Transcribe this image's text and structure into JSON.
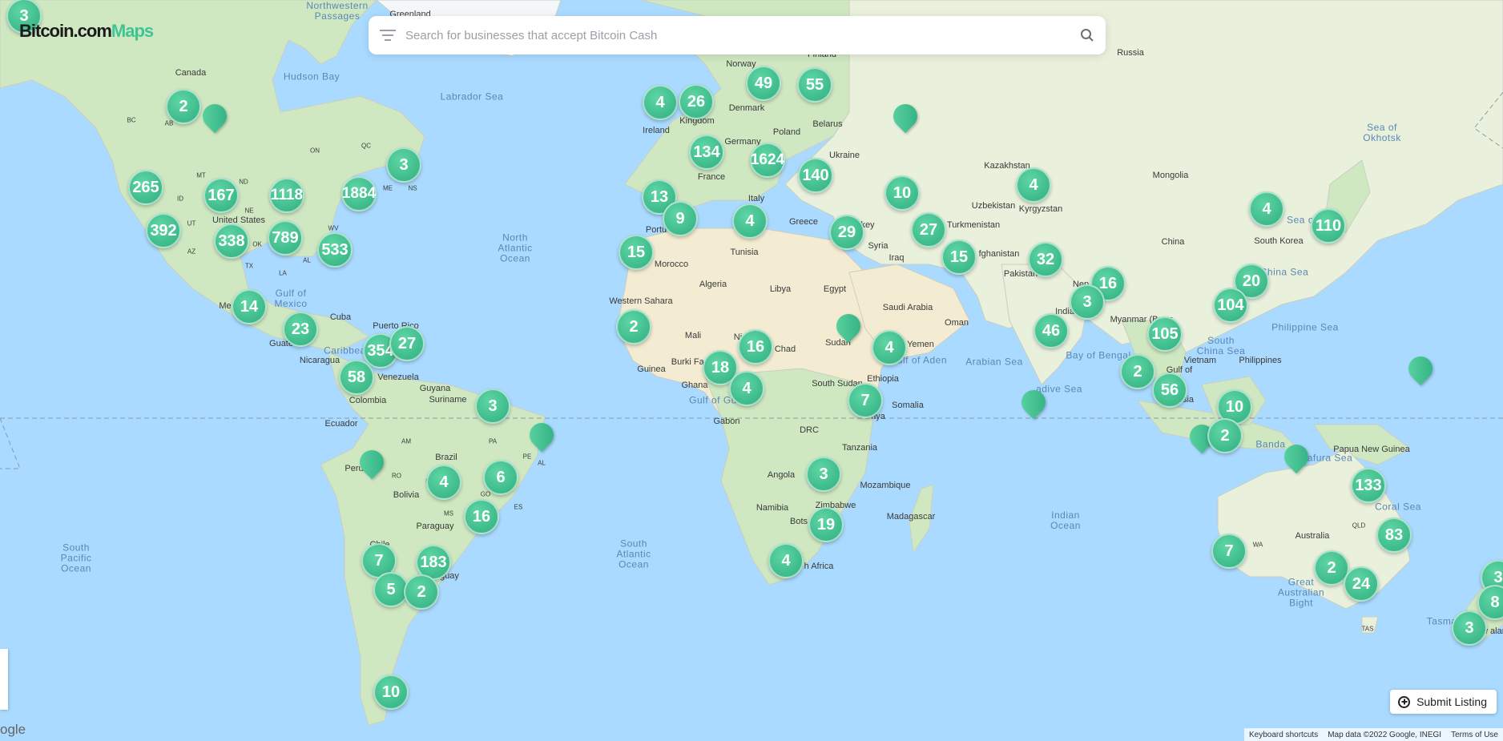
{
  "logo": {
    "brand": "Bitcoin.com",
    "product": "Maps"
  },
  "search": {
    "placeholder": "Search for businesses that accept Bitcoin Cash",
    "value": ""
  },
  "submit_listing": {
    "label": "Submit Listing"
  },
  "attribution": {
    "shortcuts": "Keyboard shortcuts",
    "map_data": "Map data ©2022 Google, INEGI",
    "terms": "Terms of Use"
  },
  "google_logo": "ogle",
  "colors": {
    "marker": "#3fc495",
    "water": "#aadaff",
    "land": "#e9f0dc"
  },
  "clusters": [
    {
      "label": "3",
      "id": "top-left"
    },
    {
      "label": "2",
      "id": "canada-west"
    },
    {
      "label": "265",
      "id": "us-northwest"
    },
    {
      "label": "167",
      "id": "us-mountain"
    },
    {
      "label": "1118",
      "id": "us-midwest"
    },
    {
      "label": "1884",
      "id": "us-northeast"
    },
    {
      "label": "3",
      "id": "canada-east"
    },
    {
      "label": "392",
      "id": "us-california"
    },
    {
      "label": "338",
      "id": "us-texas"
    },
    {
      "label": "789",
      "id": "us-south"
    },
    {
      "label": "533",
      "id": "us-southeast"
    },
    {
      "label": "14",
      "id": "mexico"
    },
    {
      "label": "23",
      "id": "central-america"
    },
    {
      "label": "354",
      "id": "caribbean"
    },
    {
      "label": "27",
      "id": "puerto-rico"
    },
    {
      "label": "58",
      "id": "colombia"
    },
    {
      "label": "3",
      "id": "guyana"
    },
    {
      "label": "4",
      "id": "brazil-west"
    },
    {
      "label": "6",
      "id": "brazil-east"
    },
    {
      "label": "16",
      "id": "brazil-south"
    },
    {
      "label": "7",
      "id": "chile-north"
    },
    {
      "label": "183",
      "id": "argentina"
    },
    {
      "label": "5",
      "id": "chile-central"
    },
    {
      "label": "2",
      "id": "uruguay"
    },
    {
      "label": "10",
      "id": "patagonia"
    },
    {
      "label": "4",
      "id": "ireland"
    },
    {
      "label": "26",
      "id": "uk"
    },
    {
      "label": "49",
      "id": "norway"
    },
    {
      "label": "55",
      "id": "finland"
    },
    {
      "label": "134",
      "id": "france"
    },
    {
      "label": "1624",
      "id": "central-europe"
    },
    {
      "label": "140",
      "id": "eastern-europe"
    },
    {
      "label": "13",
      "id": "spain"
    },
    {
      "label": "9",
      "id": "portugal"
    },
    {
      "label": "4",
      "id": "italy"
    },
    {
      "label": "29",
      "id": "turkey"
    },
    {
      "label": "10",
      "id": "caucasus"
    },
    {
      "label": "27",
      "id": "iran"
    },
    {
      "label": "15",
      "id": "pakistan"
    },
    {
      "label": "4",
      "id": "kyrgyzstan"
    },
    {
      "label": "32",
      "id": "india-north"
    },
    {
      "label": "16",
      "id": "nepal"
    },
    {
      "label": "3",
      "id": "bangladesh"
    },
    {
      "label": "46",
      "id": "india-south"
    },
    {
      "label": "15",
      "id": "morocco"
    },
    {
      "label": "2",
      "id": "mauritania"
    },
    {
      "label": "16",
      "id": "nigeria"
    },
    {
      "label": "18",
      "id": "ghana"
    },
    {
      "label": "4",
      "id": "cameroon"
    },
    {
      "label": "4",
      "id": "ethiopia"
    },
    {
      "label": "7",
      "id": "kenya"
    },
    {
      "label": "3",
      "id": "zambia"
    },
    {
      "label": "19",
      "id": "zimbabwe"
    },
    {
      "label": "4",
      "id": "south-africa"
    },
    {
      "label": "4",
      "id": "korea"
    },
    {
      "label": "110",
      "id": "japan"
    },
    {
      "label": "20",
      "id": "taiwan"
    },
    {
      "label": "104",
      "id": "hong-kong"
    },
    {
      "label": "105",
      "id": "thailand"
    },
    {
      "label": "2",
      "id": "malaysia"
    },
    {
      "label": "56",
      "id": "singapore"
    },
    {
      "label": "10",
      "id": "borneo"
    },
    {
      "label": "2",
      "id": "indonesia"
    },
    {
      "label": "133",
      "id": "queensland"
    },
    {
      "label": "83",
      "id": "brisbane"
    },
    {
      "label": "7",
      "id": "western-australia"
    },
    {
      "label": "2",
      "id": "south-australia"
    },
    {
      "label": "24",
      "id": "melbourne"
    },
    {
      "label": "3",
      "id": "new-zealand"
    },
    {
      "label": "3",
      "id": "nz-north-edge"
    },
    {
      "label": "8",
      "id": "nz-east-edge"
    }
  ],
  "pins": [
    {
      "id": "canada-pin"
    },
    {
      "id": "russia-pin"
    },
    {
      "id": "sudan-pin"
    },
    {
      "id": "maldives-pin"
    },
    {
      "id": "pacific-pin"
    },
    {
      "id": "peru-pin"
    },
    {
      "id": "brazil-coast-pin"
    },
    {
      "id": "indonesia-pin"
    },
    {
      "id": "timor-pin"
    }
  ],
  "labels": {
    "greenland": "Greenland",
    "nw_passages": "Northwestern\nPassages",
    "canada": "Canada",
    "hudson_bay": "Hudson Bay",
    "labrador_sea": "Labrador Sea",
    "us": "United States",
    "gulf_mexico": "Gulf of\nMexico",
    "cuba": "Cuba",
    "mexico": "Me",
    "guatemala": "Guate",
    "nicaragua": "Nicaragua",
    "caribbean": "Caribbean",
    "puerto_rico": "Puerto Rico",
    "venezuela": "Venezuela",
    "colombia": "Colombia",
    "guyana": "Guyana",
    "suriname": "Suriname",
    "ecuador": "Ecuador",
    "peru": "Peru",
    "brazil": "Brazil",
    "bolivia": "Bolivia",
    "paraguay": "Paraguay",
    "chile": "Chile",
    "uruguay": "guay",
    "north_atlantic": "North\nAtlantic\nOcean",
    "south_atlantic": "South\nAtlantic\nOcean",
    "south_pacific": "South\nPacific\nOcean",
    "indian_ocean": "Indian\nOcean",
    "norway": "Norway",
    "finland": "Finland",
    "russia": "Russia",
    "ireland": "Ireland",
    "kingdom": "Kingdom",
    "denmark": "Denmark",
    "belarus": "Belarus",
    "poland": "Poland",
    "germany": "Germany",
    "ukraine": "Ukraine",
    "france": "France",
    "italy": "Italy",
    "portugal": "Portu",
    "greece": "Greece",
    "turkey": "key",
    "kazakhstan": "Kazakhstan",
    "mongolia": "Mongolia",
    "uzbekistan": "Uzbekistan",
    "kyrgyzstan": "Kyrgyzstan",
    "turkmenistan": "Turkmenistan",
    "afghanistan": "fghanistan",
    "china": "China",
    "south_korea": "South Korea",
    "sea_okhotsk": "Sea of\nOkhotsk",
    "japan_sea": "Sea o",
    "syria": "Syria",
    "iraq": "Iraq",
    "pakistan": "Pakistan",
    "nepal": "Nep",
    "india": "India",
    "myanmar": "Myanmar\n(Burm",
    "tunisia": "Tunisia",
    "morocco": "Morocco",
    "algeria": "Algeria",
    "libya": "Libya",
    "egypt": "Egypt",
    "saudi": "Saudi Arabia",
    "oman": "Oman",
    "yemen": "Yemen",
    "western_sahara": "Western\nSahara",
    "mali": "Mali",
    "mauritania": "ania",
    "niger": "Ni",
    "chad": "Chad",
    "sudan": "Sudan",
    "gulf_aden": "Gulf of Aden",
    "arabian_sea": "Arabian Sea",
    "bay_bengal": "Bay of Bengal",
    "guinea": "Guinea",
    "burkina": "Burki\nFas",
    "ghana": "Ghana",
    "gulf_guinea": "Gulf of Gu",
    "gabon": "Gabon",
    "south_sudan": "South Sudan",
    "ethiopia": "Ethiopia",
    "somalia": "Somalia",
    "drc": "DRC",
    "tanzania": "Tanzania",
    "kenya": "nya",
    "angola": "Angola",
    "mozambique": "Mozambique",
    "namibia": "Namibia",
    "zimbabwe": "Zimbabwe",
    "botswana": "Bots",
    "madagascar": "Madagascar",
    "south_africa": "h Africa",
    "maldives": "adive Sea",
    "vietnam": "Vietnam",
    "south_china_sea": "South\nChina Sea",
    "philippines": "Philippines",
    "philippine_sea": "Philippine Sea",
    "east_china_sea": "China Sea",
    "banda": "Banda",
    "arafura": "afura Sea",
    "papua": "Papua New\nGuinea",
    "australia": "Australia",
    "coral_sea": "Coral Sea",
    "great_bight": "Great\nAustralian\nBight",
    "tasman": "Tasman Se",
    "nz": "w\naland",
    "wa": "WA",
    "qld": "QLD",
    "tas": "TAS",
    "gulf_thailand": "Gulf of",
    "malaysia": "sia",
    "bc": "BC",
    "ab": "AB",
    "qc": "QC",
    "on": "ON",
    "nb": "NB",
    "ns": "NS",
    "me": "ME",
    "mt": "MT",
    "id": "ID",
    "nd": "ND",
    "ut": "UT",
    "ne": "NE",
    "az": "AZ",
    "ok": "OK",
    "tx": "TX",
    "la": "LA",
    "al": "AL",
    "wv": "WV",
    "am": "AM",
    "pa": "PA",
    "pe": "PE",
    "al_br": "AL",
    "mt_br": "MT",
    "ro": "RO",
    "go": "GO",
    "es": "ES",
    "ms": "MS"
  }
}
